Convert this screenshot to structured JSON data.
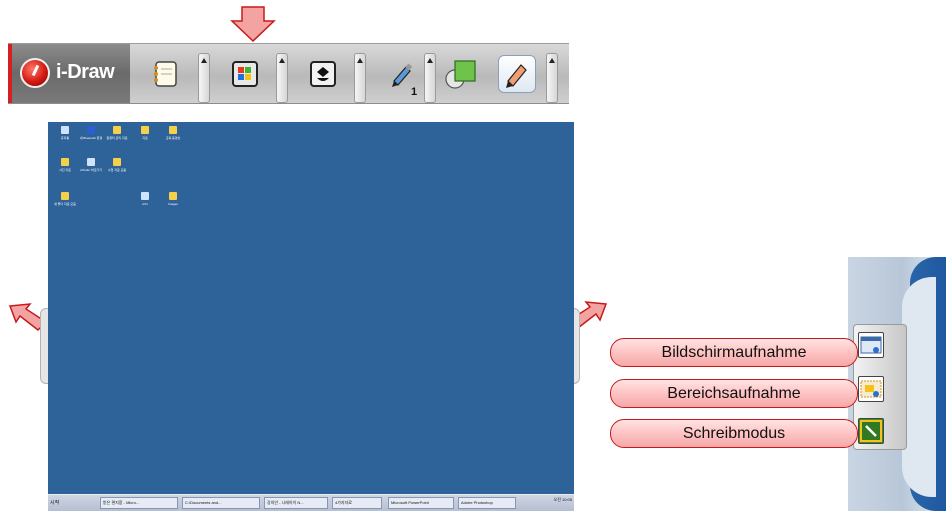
{
  "toolbar": {
    "app_name": "i-Draw",
    "pen_width": "1",
    "tools": [
      {
        "name": "notepad-icon"
      },
      {
        "name": "windows-desktop-icon"
      },
      {
        "name": "ink-bucket-icon"
      },
      {
        "name": "pen-icon"
      },
      {
        "name": "shapes-icon"
      },
      {
        "name": "pencil-icon",
        "selected": true
      }
    ]
  },
  "desktop": {
    "icons": [
      {
        "label": "휴지통",
        "icon": "recycle-bin-icon"
      },
      {
        "label": "내 Bluetooth 환경",
        "icon": "bluetooth-icon"
      },
      {
        "label": "컴퓨터 관리 자료",
        "icon": "folder-icon"
      },
      {
        "label": "자료",
        "icon": "folder-icon"
      },
      {
        "label": "교육 동영상",
        "icon": "folder-icon"
      },
      {
        "label": "사진 자료",
        "icon": "folder-icon"
      },
      {
        "label": "i-Plotter 바로가기",
        "icon": "program-icon"
      },
      {
        "label": "수업 자료 모음",
        "icon": "folder-icon"
      },
      {
        "label": "새 폴더 자료 모음",
        "icon": "folder-icon"
      },
      {
        "label": "i-Pro",
        "icon": "program-icon"
      },
      {
        "label": "Images",
        "icon": "folder-icon"
      }
    ],
    "taskbar": {
      "start_label": "시작",
      "items": [
        "받은 편지함 - Micro...",
        "C:\\Documents and...",
        "강의안 - 나래아이 N...",
        "4가지자료",
        "Microsoft PowerPoint",
        "Adobe Photoshop"
      ],
      "tray_time": "오전 10:05"
    }
  },
  "capture_menu": {
    "items": [
      {
        "label": "Bildschirmaufnahme",
        "icon": "screen-capture-icon"
      },
      {
        "label": "Bereichsaufnahme",
        "icon": "area-capture-icon"
      },
      {
        "label": "Schreibmodus",
        "icon": "writing-mode-icon"
      }
    ]
  },
  "colors": {
    "desktop_bg": "#2e6399",
    "accent_red": "#d42020",
    "pill_border": "#c61a1a",
    "arrow_fill": "#f4a3a3"
  }
}
